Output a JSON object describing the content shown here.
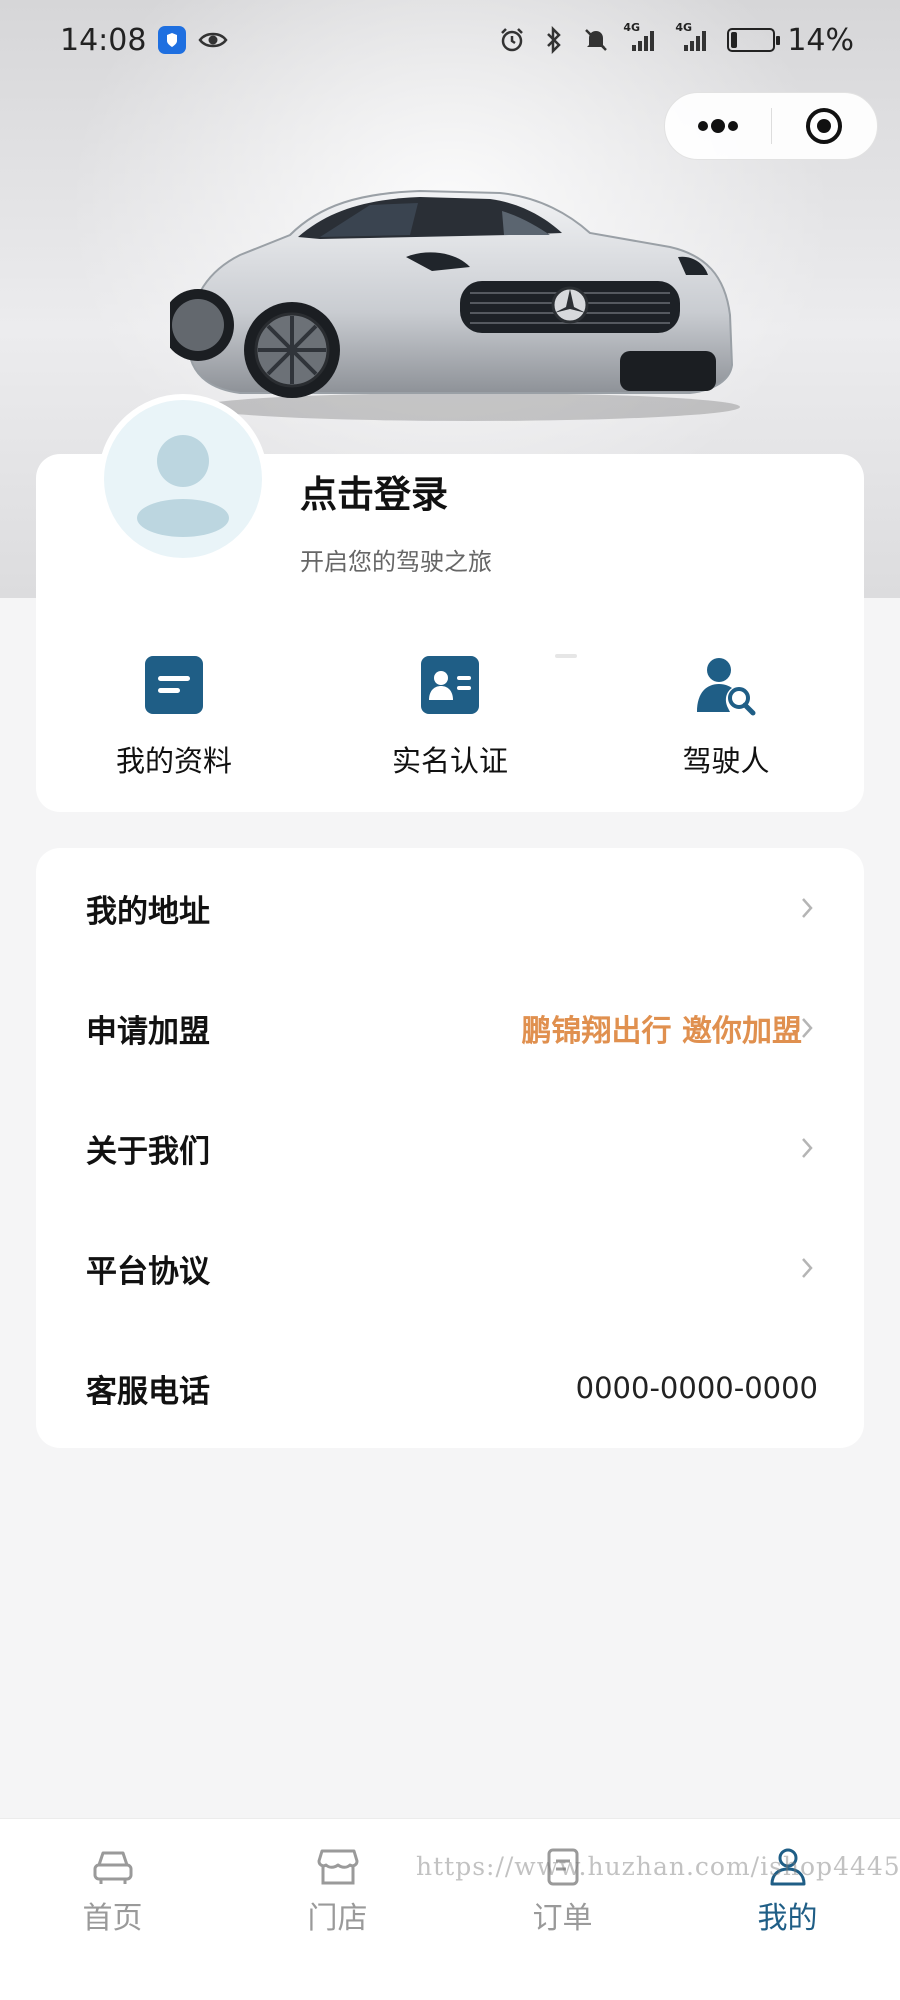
{
  "status_bar": {
    "time": "14:08",
    "battery_text": "14%",
    "battery_level": 0.14,
    "network_1": "4G",
    "network_2": "4G",
    "icons": [
      "app-badge-icon",
      "eye-icon",
      "alarm-icon",
      "bluetooth-icon",
      "mute-icon",
      "signal-icon",
      "signal-icon",
      "battery-icon"
    ]
  },
  "capsule": {
    "more_icon": "more-dots-icon",
    "close_icon": "target-close-icon"
  },
  "hero": {
    "image": "silver sports car photo"
  },
  "profile": {
    "title": "点击登录",
    "subtitle": "开启您的驾驶之旅",
    "avatar_icon": "user-avatar-icon"
  },
  "shortcuts": [
    {
      "label": "我的资料",
      "icon": "document-icon"
    },
    {
      "label": "实名认证",
      "icon": "id-card-icon"
    },
    {
      "label": "驾驶人",
      "icon": "driver-search-icon"
    }
  ],
  "menu": [
    {
      "label": "我的地址",
      "value": "",
      "chevron": true
    },
    {
      "label": "申请加盟",
      "value": "鹏锦翔出行 邀你加盟",
      "chevron": true
    },
    {
      "label": "关于我们",
      "value": "",
      "chevron": true
    },
    {
      "label": "平台协议",
      "value": "",
      "chevron": true
    },
    {
      "label": "客服电话",
      "value": "0000-0000-0000",
      "chevron": false
    }
  ],
  "tabs": [
    {
      "label": "首页",
      "icon": "car-icon",
      "active": false
    },
    {
      "label": "门店",
      "icon": "store-icon",
      "active": false
    },
    {
      "label": "订单",
      "icon": "order-icon",
      "active": false
    },
    {
      "label": "我的",
      "icon": "user-icon",
      "active": true
    }
  ],
  "watermark": "https://www.huzhan.com/ishop44453",
  "colors": {
    "primary": "#1f5e86",
    "accent": "#e0904f",
    "inactive": "#9a9a9a"
  }
}
